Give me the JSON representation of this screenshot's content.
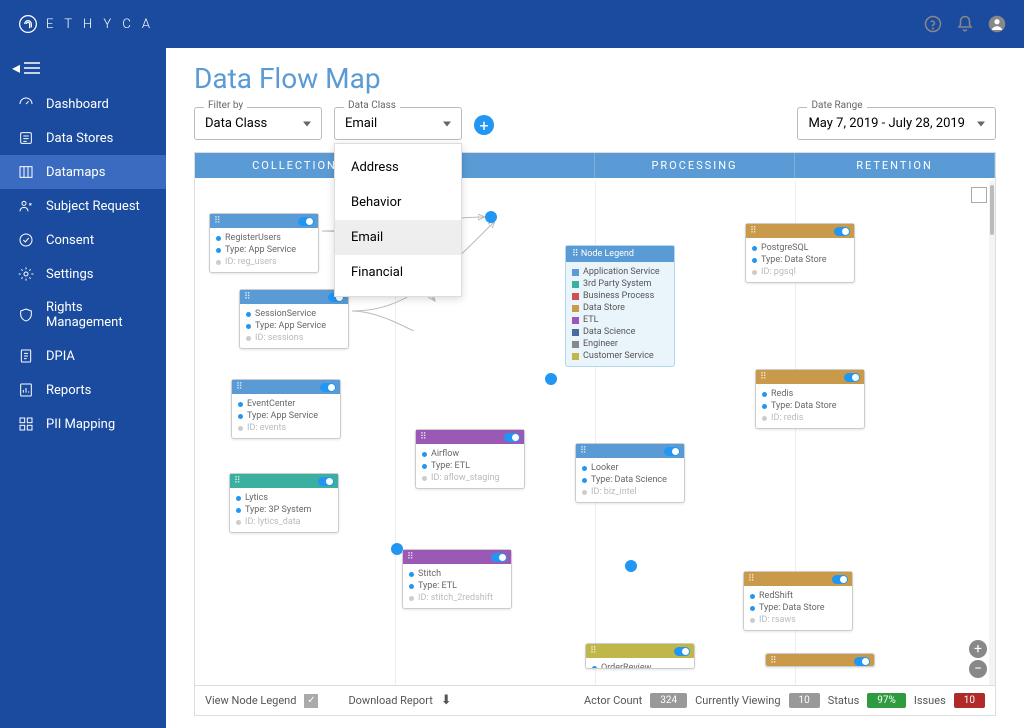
{
  "brand": "E T H Y C A",
  "sidebar": {
    "items": [
      {
        "label": "Dashboard"
      },
      {
        "label": "Data Stores"
      },
      {
        "label": "Datamaps"
      },
      {
        "label": "Subject Request"
      },
      {
        "label": "Consent"
      },
      {
        "label": "Settings"
      },
      {
        "label": "Rights Management"
      },
      {
        "label": "DPIA"
      },
      {
        "label": "Reports"
      },
      {
        "label": "PII Mapping"
      }
    ]
  },
  "page": {
    "title": "Data Flow Map"
  },
  "filters": {
    "filter_by_label": "Filter by",
    "filter_by_value": "Data Class",
    "data_class_label": "Data Class",
    "data_class_value": "Email",
    "date_label": "Date Range",
    "date_value": "May 7, 2019 - July 28, 2019",
    "options": [
      "Address",
      "Behavior",
      "Email",
      "Financial"
    ]
  },
  "columns": [
    "COLLECTION",
    "",
    "PROCESSING",
    "RETENTION"
  ],
  "nodes": {
    "register": {
      "title": "RegisterUsers",
      "type": "Type: App Service",
      "id": "ID: reg_users",
      "color": "#5b9bd5"
    },
    "session": {
      "title": "SessionService",
      "type": "Type: App Service",
      "id": "ID: sessions",
      "color": "#5b9bd5"
    },
    "event": {
      "title": "EventCenter",
      "type": "Type: App Service",
      "id": "ID: events",
      "color": "#5b9bd5"
    },
    "lytics": {
      "title": "Lytics",
      "type": "Type: 3P System",
      "id": "ID: lytics_data",
      "color": "#3bb0a0"
    },
    "airflow": {
      "title": "Airflow",
      "type": "Type: ETL",
      "id": "ID: aflow_staging",
      "color": "#9b59b6"
    },
    "stitch": {
      "title": "Stitch",
      "type": "Type: ETL",
      "id": "ID: stitch_2redshift",
      "color": "#9b59b6"
    },
    "looker": {
      "title": "Looker",
      "type": "Type: Data Science",
      "id": "ID: biz_intel",
      "color": "#5b9bd5"
    },
    "pgsql": {
      "title": "PostgreSQL",
      "type": "Type: Data Store",
      "id": "ID: pgsql",
      "color": "#c99a4a"
    },
    "redis": {
      "title": "Redis",
      "type": "Type: Data Store",
      "id": "ID: redis",
      "color": "#c99a4a"
    },
    "redshift": {
      "title": "RedShift",
      "type": "Type: Data Store",
      "id": "ID: rsaws",
      "color": "#c99a4a"
    },
    "order": {
      "title": "OrderReview",
      "color": "#c0b74a"
    }
  },
  "legend": {
    "title": "Node Legend",
    "items": [
      {
        "label": "Application Service",
        "color": "#5b9bd5"
      },
      {
        "label": "3rd Party System",
        "color": "#3bb0a0"
      },
      {
        "label": "Business Process",
        "color": "#d05050"
      },
      {
        "label": "Data Store",
        "color": "#c99a4a"
      },
      {
        "label": "ETL",
        "color": "#9b59b6"
      },
      {
        "label": "Data Science",
        "color": "#4a6aa0"
      },
      {
        "label": "Engineer",
        "color": "#888888"
      },
      {
        "label": "Customer Service",
        "color": "#c0b74a"
      }
    ]
  },
  "statusbar": {
    "view_legend": "View Node Legend",
    "download": "Download Report",
    "actor_label": "Actor Count",
    "actor_value": "324",
    "viewing_label": "Currently Viewing",
    "viewing_value": "10",
    "status_label": "Status",
    "status_value": "97%",
    "issues_label": "Issues",
    "issues_value": "10"
  }
}
